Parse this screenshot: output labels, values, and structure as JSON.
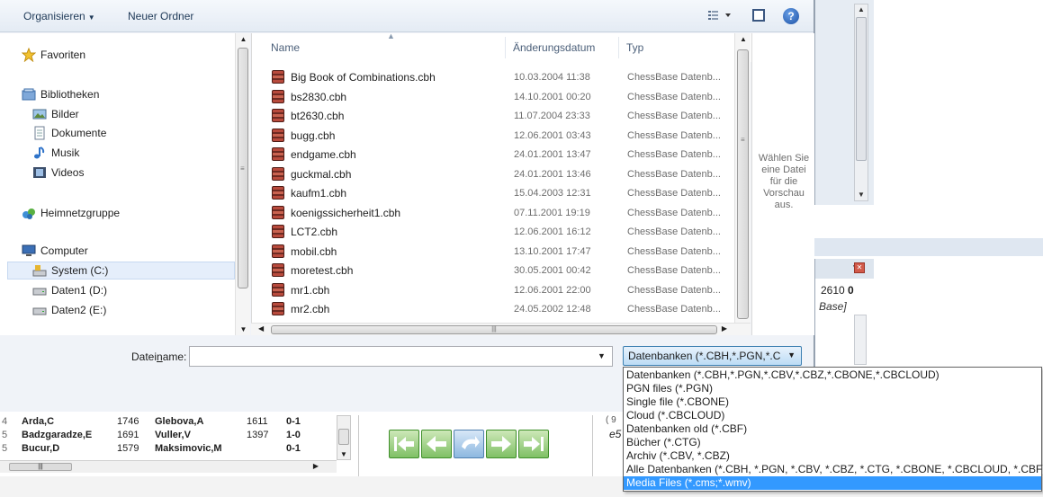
{
  "toolbar": {
    "organize_label": "Organisieren",
    "organize_caret": "▼",
    "new_folder_label": "Neuer Ordner",
    "views_icon": "views-icon",
    "preview_icon": "preview-pane-icon",
    "help_icon": "?"
  },
  "nav": {
    "favorites": "Favoriten",
    "libraries": "Bibliotheken",
    "pictures": "Bilder",
    "documents": "Dokumente",
    "music": "Musik",
    "videos": "Videos",
    "homegroup": "Heimnetzgruppe",
    "computer": "Computer",
    "drive_c": "System (C:)",
    "drive_d": "Daten1 (D:)",
    "drive_e": "Daten2 (E:)"
  },
  "columns": {
    "name": "Name",
    "date": "Änderungsdatum",
    "type": "Typ"
  },
  "files": [
    {
      "name": "Big Book of Combinations.cbh",
      "date": "10.03.2004 11:38",
      "type": "ChessBase Datenb..."
    },
    {
      "name": "bs2830.cbh",
      "date": "14.10.2001 00:20",
      "type": "ChessBase Datenb..."
    },
    {
      "name": "bt2630.cbh",
      "date": "11.07.2004 23:33",
      "type": "ChessBase Datenb..."
    },
    {
      "name": "bugg.cbh",
      "date": "12.06.2001 03:43",
      "type": "ChessBase Datenb..."
    },
    {
      "name": "endgame.cbh",
      "date": "24.01.2001 13:47",
      "type": "ChessBase Datenb..."
    },
    {
      "name": "guckmal.cbh",
      "date": "24.01.2001 13:46",
      "type": "ChessBase Datenb..."
    },
    {
      "name": "kaufm1.cbh",
      "date": "15.04.2003 12:31",
      "type": "ChessBase Datenb..."
    },
    {
      "name": "koenigssicherheit1.cbh",
      "date": "07.11.2001 19:19",
      "type": "ChessBase Datenb..."
    },
    {
      "name": "LCT2.cbh",
      "date": "12.06.2001 16:12",
      "type": "ChessBase Datenb..."
    },
    {
      "name": "mobil.cbh",
      "date": "13.10.2001 17:47",
      "type": "ChessBase Datenb..."
    },
    {
      "name": "moretest.cbh",
      "date": "30.05.2001 00:42",
      "type": "ChessBase Datenb..."
    },
    {
      "name": "mr1.cbh",
      "date": "12.06.2001 22:00",
      "type": "ChessBase Datenb..."
    },
    {
      "name": "mr2.cbh",
      "date": "24.05.2002 12:48",
      "type": "ChessBase Datenb..."
    }
  ],
  "preview": {
    "message": "Wählen Sie eine Datei für die Vorschau aus."
  },
  "filename": {
    "label_before": "Datei",
    "label_underlined": "n",
    "label_after": "ame:",
    "value": "",
    "placeholder": ""
  },
  "filter": {
    "selected": "Datenbanken (*.CBH,*.PGN,*.C",
    "options": [
      "Datenbanken (*.CBH,*.PGN,*.CBV,*.CBZ,*.CBONE,*.CBCLOUD)",
      "PGN files (*.PGN)",
      "Single file (*.CBONE)",
      "Cloud (*.CBCLOUD)",
      "Datenbanken old (*.CBF)",
      "Bücher (*.CTG)",
      "Archiv (*.CBV, *.CBZ)",
      "Alle Datenbanken (*.CBH, *.PGN, *.CBV, *.CBZ, *.CTG, *.CBONE, *.CBCLOUD, *.CBF)",
      "Media Files (*.cms;*.wmv)"
    ],
    "highlighted_index": 8
  },
  "background": {
    "elo_value": "2610",
    "elo_suffix": "0",
    "base_text": "Base]",
    "notation_top": "( 9",
    "notation_move": "e5",
    "games": [
      {
        "num": "4",
        "white": "Arda,C",
        "welo": "1746",
        "black": "Glebova,A",
        "belo": "1611",
        "result": "0-1"
      },
      {
        "num": "5",
        "white": "Badzgaradze,E",
        "welo": "1691",
        "black": "Vuller,V",
        "belo": "1397",
        "result": "1-0"
      },
      {
        "num": "5",
        "white": "Bucur,D",
        "welo": "1579",
        "black": "Maksimovic,M",
        "belo": "",
        "result": "0-1"
      }
    ]
  },
  "colors": {
    "accent": "#3399ff",
    "filter_select_border": "#3c7fb1",
    "nav_green": "#7fc065"
  }
}
